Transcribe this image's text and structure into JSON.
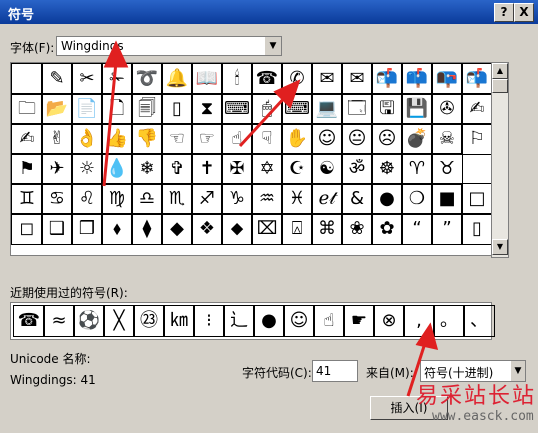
{
  "window": {
    "title": "符号",
    "help_btn": "?",
    "close_btn": "X"
  },
  "font_label": "字体(F):",
  "font_value": "Wingdings",
  "grid_rows": [
    [
      " ",
      "✎",
      "✂",
      "✁",
      "➰",
      "🔔",
      "📖",
      "🕯",
      "☎",
      "✆",
      "✉",
      "✉",
      "📬",
      "📫",
      "📭",
      "📬"
    ],
    [
      "🗀",
      "📂",
      "📄",
      "🗋",
      "🗐",
      "▯",
      "⧗",
      "⌨",
      "🖱",
      "⌨",
      "💻",
      "🗔",
      "🖫",
      "💾",
      "✇",
      "✍"
    ],
    [
      "✍",
      "✌",
      "👌",
      "👍",
      "👎",
      "☜",
      "☞",
      "☝",
      "☟",
      "✋",
      "☺",
      "😐",
      "☹",
      "💣",
      "☠",
      "⚐"
    ],
    [
      "⚑",
      "✈",
      "☼",
      "💧",
      "❄",
      "✞",
      "✝",
      "✠",
      "✡",
      "☪",
      "☯",
      "ॐ",
      "☸",
      "♈",
      "♉"
    ],
    [
      "♊",
      "♋",
      "♌",
      "♍",
      "♎",
      "♏",
      "♐",
      "♑",
      "♒",
      "♓",
      "ℯ𝓉",
      "&",
      "●",
      "❍",
      "■",
      "□"
    ],
    [
      "◻",
      "❑",
      "❒",
      "⬧",
      "⧫",
      "◆",
      "❖",
      "⬥",
      "⌧",
      "⍓",
      "⌘",
      "❀",
      "✿",
      "“",
      "”",
      "▯"
    ]
  ],
  "selected_cell": "6,3",
  "recent_label": "近期使用过的符号(R):",
  "recent": [
    "☎",
    "≈",
    "⚽",
    "╳",
    "㉓",
    "㎞",
    "⁝",
    "辶",
    "●",
    "☺",
    "☝",
    "☛",
    "⊗",
    ",",
    "。",
    "、"
  ],
  "unicode_name_label": "Unicode 名称:",
  "char_name": "Wingdings: 41",
  "char_code_label": "字符代码(C):",
  "char_code_value": "41",
  "from_label": "来自(M):",
  "from_value": "符号(十进制)",
  "insert_button": "插入(I)",
  "watermark": "易采站长站",
  "watermark_url": "www.easck.com"
}
